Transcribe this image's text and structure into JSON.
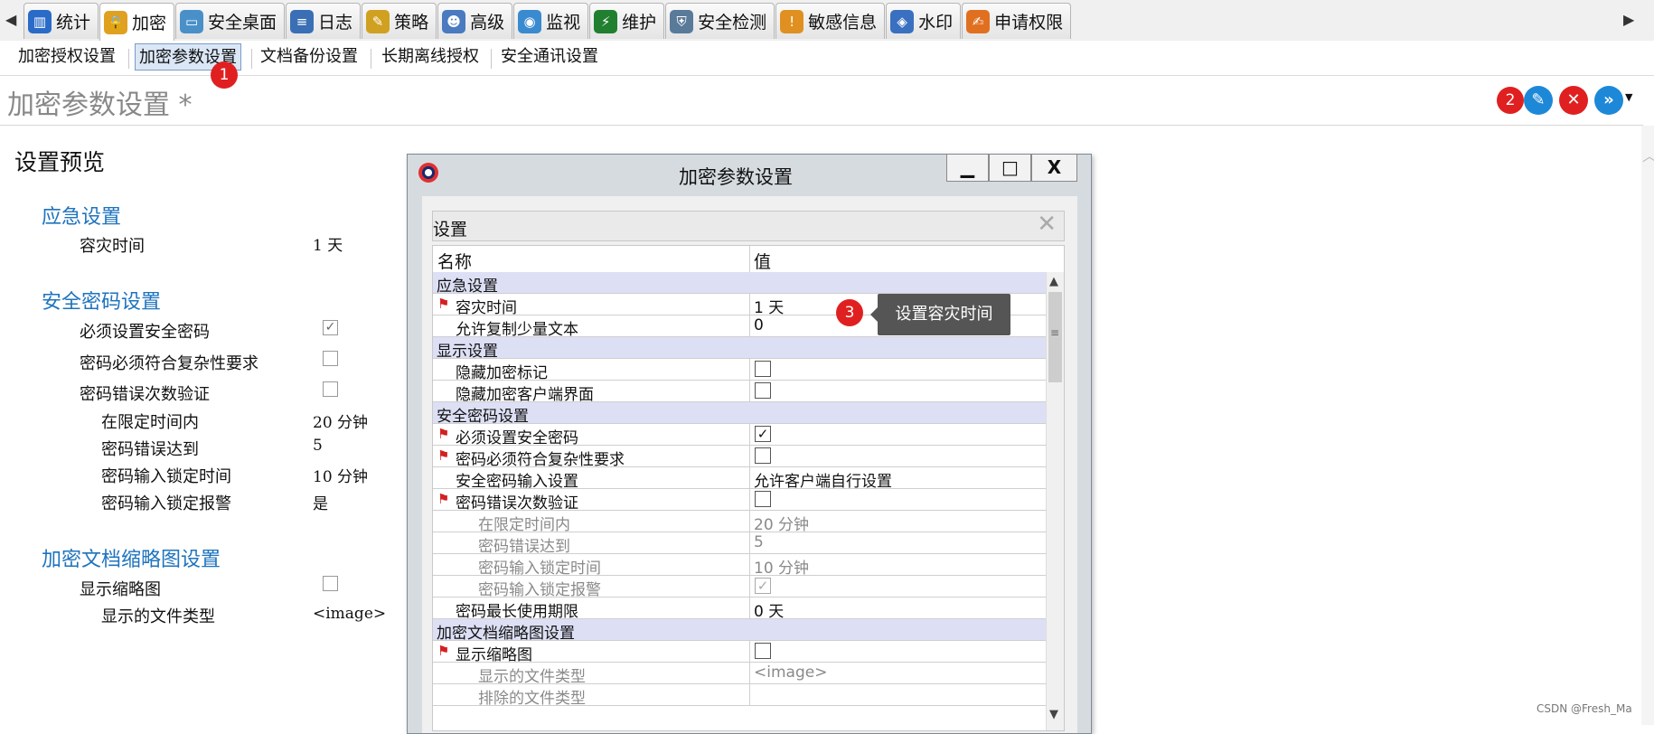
{
  "tabs": [
    {
      "label": "统计",
      "icon": "chart-icon",
      "color": "#2a6bc8"
    },
    {
      "label": "加密",
      "icon": "lock-icon",
      "color": "#e0a020"
    },
    {
      "label": "安全桌面",
      "icon": "desktop-icon",
      "color": "#4a90c8"
    },
    {
      "label": "日志",
      "icon": "log-icon",
      "color": "#3a6fb5"
    },
    {
      "label": "策略",
      "icon": "policy-icon",
      "color": "#d0a020"
    },
    {
      "label": "高级",
      "icon": "people-icon",
      "color": "#4a7ac0"
    },
    {
      "label": "监视",
      "icon": "monitor-icon",
      "color": "#3a8ad0"
    },
    {
      "label": "维护",
      "icon": "maintenance-icon",
      "color": "#208030"
    },
    {
      "label": "安全检测",
      "icon": "shield-scan-icon",
      "color": "#5a7a9a"
    },
    {
      "label": "敏感信息",
      "icon": "warning-icon",
      "color": "#e09020"
    },
    {
      "label": "水印",
      "icon": "watermark-icon",
      "color": "#3a70c0"
    },
    {
      "label": "申请权限",
      "icon": "request-icon",
      "color": "#e07020"
    }
  ],
  "subtabs": [
    "加密授权设置",
    "加密参数设置",
    "文档备份设置",
    "长期离线授权",
    "安全通讯设置"
  ],
  "page_title": "加密参数设置 *",
  "badges": {
    "one": "1",
    "two": "2",
    "three": "3"
  },
  "preview": {
    "title": "设置预览",
    "emergency": {
      "title": "应急设置",
      "disaster_label": "容灾时间",
      "disaster_value": "1 天"
    },
    "password": {
      "title": "安全密码设置",
      "must_set": "必须设置安全密码",
      "complexity": "密码必须符合复杂性要求",
      "error_verify": "密码错误次数验证",
      "within_time": "在限定时间内",
      "within_time_value": "20 分钟",
      "errors_reach": "密码错误达到",
      "errors_reach_value": "5",
      "lock_time": "密码输入锁定时间",
      "lock_time_value": "10 分钟",
      "lock_alarm": "密码输入锁定报警",
      "lock_alarm_value": "是"
    },
    "thumbnail": {
      "title": "加密文档缩略图设置",
      "show": "显示缩略图",
      "types": "显示的文件类型",
      "types_value": "<image>"
    }
  },
  "dialog": {
    "title": "加密参数设置",
    "min_symbol": "▁",
    "max_symbol": "□",
    "close_symbol": "X",
    "settings_label": "设置",
    "clear_symbol": "✕",
    "col_name": "名称",
    "col_value": "值",
    "rows": {
      "s1": "应急设置",
      "r1_name": "容灾时间",
      "r1_value": "1 天",
      "r2_name": "允许复制少量文本",
      "r2_value": "0",
      "s2": "显示设置",
      "r3_name": "隐藏加密标记",
      "r4_name": "隐藏加密客户端界面",
      "s3": "安全密码设置",
      "r5_name": "必须设置安全密码",
      "r6_name": "密码必须符合复杂性要求",
      "r7_name": "安全密码输入设置",
      "r7_value": "允许客户端自行设置",
      "r8_name": "密码错误次数验证",
      "r9_name": "在限定时间内",
      "r9_value": "20 分钟",
      "r10_name": "密码错误达到",
      "r10_value": "5",
      "r11_name": "密码输入锁定时间",
      "r11_value": "10 分钟",
      "r12_name": "密码输入锁定报警",
      "r13_name": "密码最长使用期限",
      "r13_value": "0 天",
      "s4": "加密文档缩略图设置",
      "r14_name": "显示缩略图",
      "r15_name": "显示的文件类型",
      "r15_value": "<image>",
      "r16_name": "排除的文件类型"
    }
  },
  "tooltip": "设置容灾时间",
  "watermark": "CSDN @Fresh_Ma",
  "colors": {
    "accent_blue": "#1e73be",
    "badge_red": "#e02020",
    "section_bg": "#dde0f5"
  }
}
